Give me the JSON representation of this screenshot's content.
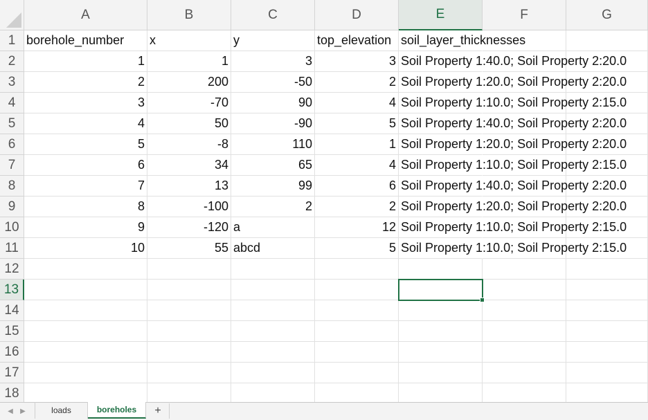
{
  "sheet": {
    "columns": [
      "A",
      "B",
      "C",
      "D",
      "E",
      "F",
      "G"
    ],
    "active_column": "E",
    "row_numbers": [
      "1",
      "2",
      "3",
      "4",
      "5",
      "6",
      "7",
      "8",
      "9",
      "10",
      "11",
      "12",
      "13",
      "14",
      "15",
      "16",
      "17",
      "18"
    ],
    "active_row": "13",
    "header_row": [
      "borehole_number",
      "x",
      "y",
      "top_elevation",
      "soil_layer_thicknesses"
    ],
    "rows": [
      [
        "1",
        "1",
        "3",
        "3",
        "Soil Property 1:40.0; Soil Property 2:20.0"
      ],
      [
        "2",
        "200",
        "-50",
        "2",
        "Soil Property 1:20.0; Soil Property 2:20.0"
      ],
      [
        "3",
        "-70",
        "90",
        "4",
        "Soil Property 1:10.0; Soil Property 2:15.0"
      ],
      [
        "4",
        "50",
        "-90",
        "5",
        "Soil Property 1:40.0; Soil Property 2:20.0"
      ],
      [
        "5",
        "-8",
        "110",
        "1",
        "Soil Property 1:20.0; Soil Property 2:20.0"
      ],
      [
        "6",
        "34",
        "65",
        "4",
        "Soil Property 1:10.0; Soil Property 2:15.0"
      ],
      [
        "7",
        "13",
        "99",
        "6",
        "Soil Property 1:40.0; Soil Property 2:20.0"
      ],
      [
        "8",
        "-100",
        "2",
        "2",
        "Soil Property 1:20.0; Soil Property 2:20.0"
      ],
      [
        "9",
        "-120",
        "a",
        "12",
        "Soil Property 1:10.0; Soil Property 2:15.0"
      ],
      [
        "10",
        "55",
        "abcd",
        "5",
        "Soil Property 1:10.0; Soil Property 2:15.0"
      ]
    ],
    "selected_cell": "E13"
  },
  "tabs": {
    "items": [
      "loads",
      "boreholes"
    ],
    "active": "boreholes",
    "add_label": "+",
    "prev_icon": "triangle-left-icon",
    "next_icon": "triangle-right-icon"
  },
  "colors": {
    "accent": "#217346",
    "header_bg": "#f3f3f3",
    "grid": "#e1e1e1"
  }
}
